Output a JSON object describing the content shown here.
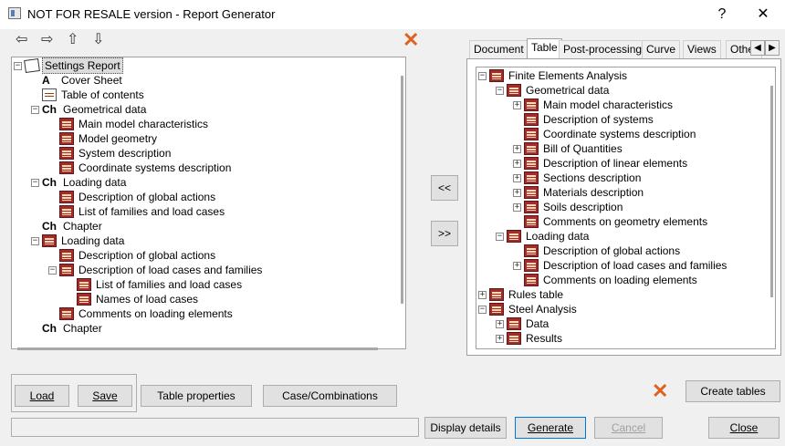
{
  "window": {
    "title": "NOT FOR RESALE version - Report Generator",
    "help": "?",
    "close": "✕"
  },
  "toolbar": {
    "left": "⇦",
    "right": "⇨",
    "up": "⇧",
    "down": "⇩"
  },
  "left_tree": [
    {
      "d": 0,
      "exp": "−",
      "icon": "rep",
      "label": "Settings Report",
      "sel": true
    },
    {
      "d": 1,
      "icon": "aa",
      "label": "Cover Sheet"
    },
    {
      "d": 1,
      "icon": "doc",
      "label": "Table of contents"
    },
    {
      "d": 1,
      "exp": "−",
      "icon": "ch",
      "label": "Geometrical data"
    },
    {
      "d": 2,
      "icon": "tbl",
      "label": "Main model characteristics"
    },
    {
      "d": 2,
      "icon": "tbl",
      "label": "Model geometry"
    },
    {
      "d": 2,
      "icon": "tbl",
      "label": "System description"
    },
    {
      "d": 2,
      "icon": "tbl",
      "label": "Coordinate systems description"
    },
    {
      "d": 1,
      "exp": "−",
      "icon": "ch",
      "label": "Loading data"
    },
    {
      "d": 2,
      "icon": "tbl",
      "label": "Description of global actions"
    },
    {
      "d": 2,
      "icon": "tbl",
      "label": "List of families and load cases"
    },
    {
      "d": 1,
      "icon": "ch",
      "label": "Chapter"
    },
    {
      "d": 1,
      "exp": "−",
      "icon": "tbl",
      "label": "Loading data"
    },
    {
      "d": 2,
      "icon": "tbl",
      "label": "Description of global actions"
    },
    {
      "d": 2,
      "exp": "−",
      "icon": "tbl",
      "label": "Description of load cases and families"
    },
    {
      "d": 3,
      "icon": "tbl",
      "label": "List of families and load cases"
    },
    {
      "d": 3,
      "icon": "tbl",
      "label": "Names of load cases"
    },
    {
      "d": 2,
      "icon": "tbl",
      "label": "Comments on loading elements"
    },
    {
      "d": 1,
      "icon": "ch",
      "label": "Chapter"
    }
  ],
  "tabs": [
    "Document",
    "Table",
    "Post-processing",
    "Curve",
    "Views",
    "Other"
  ],
  "active_tab": "Table",
  "right_tree": [
    {
      "d": 0,
      "exp": "−",
      "icon": "tbl",
      "label": "Finite Elements Analysis"
    },
    {
      "d": 1,
      "exp": "−",
      "icon": "tbl",
      "label": "Geometrical data"
    },
    {
      "d": 2,
      "exp": "+",
      "icon": "tbl",
      "label": "Main model characteristics"
    },
    {
      "d": 2,
      "icon": "tbl",
      "label": "Description of systems"
    },
    {
      "d": 2,
      "icon": "tbl",
      "label": "Coordinate systems description"
    },
    {
      "d": 2,
      "exp": "+",
      "icon": "tbl",
      "label": "Bill of Quantities"
    },
    {
      "d": 2,
      "exp": "+",
      "icon": "tbl",
      "label": "Description of linear elements"
    },
    {
      "d": 2,
      "exp": "+",
      "icon": "tbl",
      "label": "Sections description"
    },
    {
      "d": 2,
      "exp": "+",
      "icon": "tbl",
      "label": "Materials description"
    },
    {
      "d": 2,
      "exp": "+",
      "icon": "tbl",
      "label": "Soils description"
    },
    {
      "d": 2,
      "icon": "tbl",
      "label": "Comments on geometry elements"
    },
    {
      "d": 1,
      "exp": "−",
      "icon": "tbl",
      "label": "Loading data"
    },
    {
      "d": 2,
      "icon": "tbl",
      "label": "Description of global actions"
    },
    {
      "d": 2,
      "exp": "+",
      "icon": "tbl",
      "label": "Description of load cases and families"
    },
    {
      "d": 2,
      "icon": "tbl",
      "label": "Comments on loading elements"
    },
    {
      "d": 0,
      "exp": "+",
      "icon": "tbl",
      "label": "Rules table"
    },
    {
      "d": 0,
      "exp": "−",
      "icon": "tbl",
      "label": "Steel Analysis"
    },
    {
      "d": 1,
      "exp": "+",
      "icon": "tbl",
      "label": "Data"
    },
    {
      "d": 1,
      "exp": "+",
      "icon": "tbl",
      "label": "Results"
    }
  ],
  "transfer": {
    "left": "<<",
    "right": ">>"
  },
  "buttons": {
    "load": "Load",
    "save": "Save",
    "table_properties": "Table properties",
    "case_combinations": "Case/Combinations",
    "create_tables": "Create tables",
    "display_details": "Display details",
    "generate": "Generate",
    "cancel": "Cancel",
    "close": "Close"
  },
  "status_text": "",
  "colors": {
    "delete_icon": "#e06020",
    "table_icon": "#a52a2a"
  }
}
